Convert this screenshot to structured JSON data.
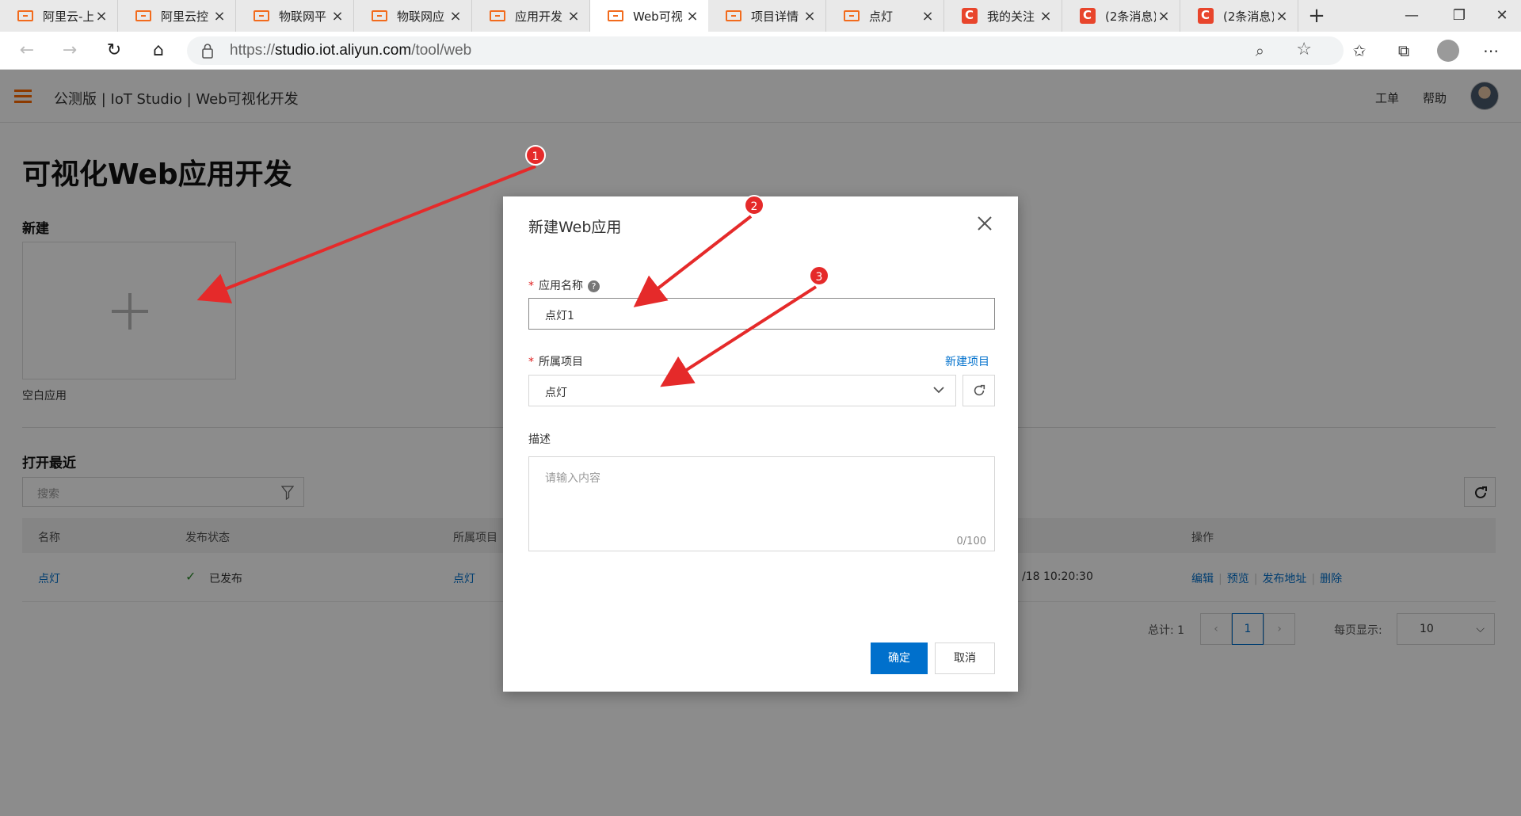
{
  "browser": {
    "tabs": [
      {
        "label": "阿里云-上",
        "icon": "aliyun-icon"
      },
      {
        "label": "阿里云控",
        "icon": "aliyun-icon"
      },
      {
        "label": "物联网平",
        "icon": "aliyun-icon"
      },
      {
        "label": "物联网应",
        "icon": "aliyun-icon"
      },
      {
        "label": "应用开发",
        "icon": "aliyun-icon"
      },
      {
        "label": "Web可视",
        "icon": "aliyun-icon",
        "active": true
      },
      {
        "label": "项目详情",
        "icon": "aliyun-icon"
      },
      {
        "label": "点灯",
        "icon": "aliyun-icon"
      },
      {
        "label": "我的关注",
        "icon": "csdn-icon"
      },
      {
        "label": "(2条消息)",
        "icon": "csdn-icon"
      },
      {
        "label": "(2条消息)",
        "icon": "csdn-icon"
      }
    ],
    "url_prefix": "https://",
    "url_host": "studio.iot.aliyun.com",
    "url_path": "/tool/web"
  },
  "app": {
    "header_title": "公测版 | IoT Studio | Web可视化开发",
    "header_links": {
      "tickets": "工单",
      "help": "帮助"
    },
    "page_title": "可视化Web应用开发",
    "new_section": "新建",
    "blank_app_label": "空白应用",
    "recent_section": "打开最近",
    "search_placeholder": "搜索",
    "table": {
      "columns": {
        "name": "名称",
        "status": "发布状态",
        "project": "所属项目",
        "actions": "操作"
      },
      "rows": [
        {
          "name": "点灯",
          "status": "已发布",
          "project": "点灯",
          "time": "/18 10:20:30",
          "actions": {
            "edit": "编辑",
            "preview": "预览",
            "publish_url": "发布地址",
            "delete": "删除"
          }
        }
      ]
    },
    "pagination": {
      "total_label": "总计: 1",
      "current_page": "1",
      "page_size_label": "每页显示:",
      "page_size": "10"
    }
  },
  "modal": {
    "title": "新建Web应用",
    "app_name_label": "应用名称",
    "app_name_value": "点灯1",
    "project_label": "所属项目",
    "new_project_link": "新建项目",
    "project_value": "点灯",
    "description_label": "描述",
    "description_placeholder": "请输入内容",
    "char_count": "0/100",
    "confirm_label": "确定",
    "cancel_label": "取消"
  },
  "annotations": {
    "badges": [
      "1",
      "2",
      "3"
    ],
    "color": "#e52a2a"
  },
  "colors": {
    "accent": "#0070cc",
    "brand": "#ff6a00",
    "required": "#e02020"
  }
}
